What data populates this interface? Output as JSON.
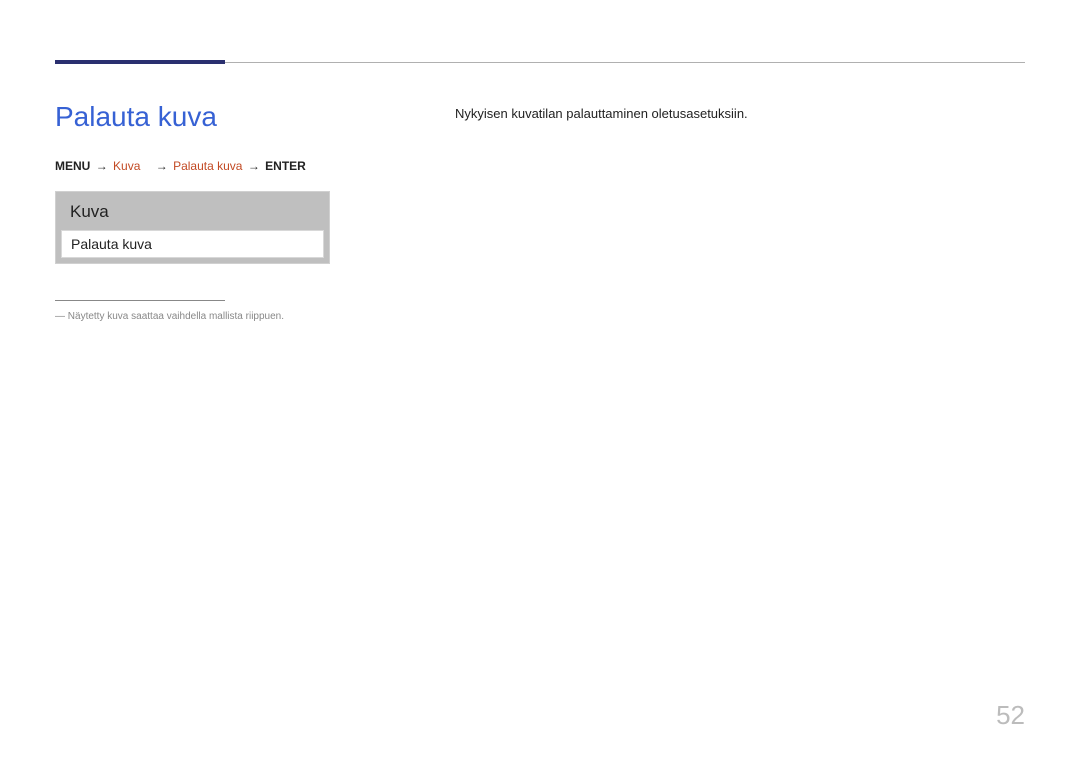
{
  "heading": "Palauta kuva",
  "breadcrumb": {
    "menu": "MENU",
    "kuva": "Kuva",
    "palauta": "Palauta kuva",
    "enter": "ENTER",
    "arrow": "→"
  },
  "menu_mock": {
    "title": "Kuva",
    "item": "Palauta kuva"
  },
  "footnote": {
    "marker": "―",
    "text": "Näytetty kuva saattaa vaihdella mallista riippuen."
  },
  "description": "Nykyisen kuvatilan palauttaminen oletusasetuksiin.",
  "page_number": "52"
}
